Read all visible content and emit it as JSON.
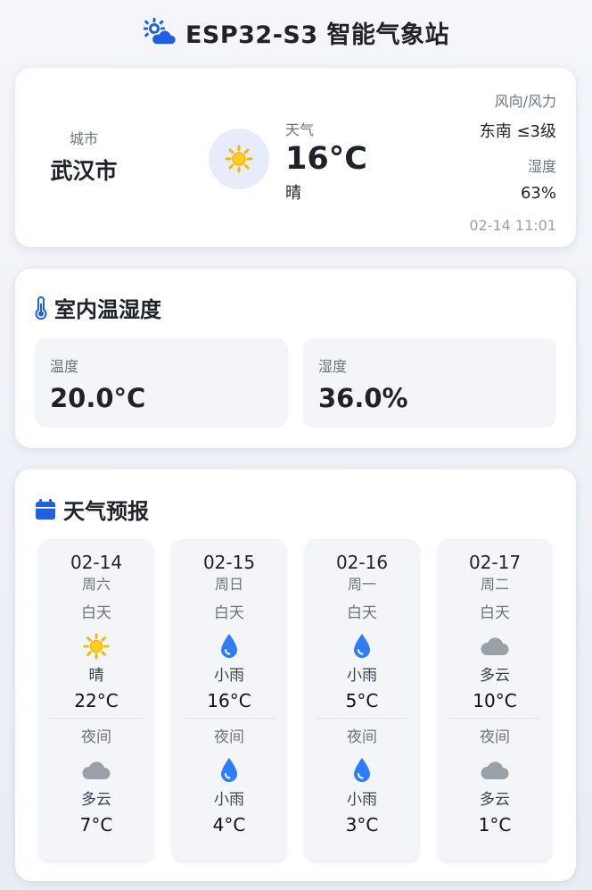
{
  "header": {
    "title": "ESP32-S3 智能气象站",
    "icon": "sun-cloud-icon"
  },
  "current": {
    "city_label": "城市",
    "city": "武汉市",
    "weather_label": "天气",
    "temperature": "16°C",
    "weather": "晴",
    "weather_icon": "sun-icon",
    "wind_label": "风向/风力",
    "wind": "东南 ≤3级",
    "humidity_label": "湿度",
    "humidity": "63%",
    "updated": "02-14 11:01"
  },
  "indoor": {
    "title": "室内温湿度",
    "icon": "thermometer-icon",
    "temperature_label": "温度",
    "temperature": "20.0°C",
    "humidity_label": "湿度",
    "humidity": "36.0%"
  },
  "forecast": {
    "title": "天气预报",
    "icon": "calendar-icon",
    "day_label": "白天",
    "night_label": "夜间",
    "days": [
      {
        "date": "02-14",
        "weekday": "周六",
        "day_icon": "sun-icon",
        "day_cond": "晴",
        "day_temp": "22°C",
        "night_icon": "cloud-icon",
        "night_cond": "多云",
        "night_temp": "7°C"
      },
      {
        "date": "02-15",
        "weekday": "周日",
        "day_icon": "raindrop-icon",
        "day_cond": "小雨",
        "day_temp": "16°C",
        "night_icon": "raindrop-icon",
        "night_cond": "小雨",
        "night_temp": "4°C"
      },
      {
        "date": "02-16",
        "weekday": "周一",
        "day_icon": "raindrop-icon",
        "day_cond": "小雨",
        "day_temp": "5°C",
        "night_icon": "raindrop-icon",
        "night_cond": "小雨",
        "night_temp": "3°C"
      },
      {
        "date": "02-17",
        "weekday": "周二",
        "day_icon": "cloud-icon",
        "day_cond": "多云",
        "day_temp": "10°C",
        "night_icon": "cloud-icon",
        "night_cond": "多云",
        "night_temp": "1°C"
      }
    ]
  },
  "colors": {
    "accent": "#1f5fe0",
    "sun": "#f5b800",
    "cloud": "#9aa0a8",
    "rain": "#2f7df6"
  }
}
